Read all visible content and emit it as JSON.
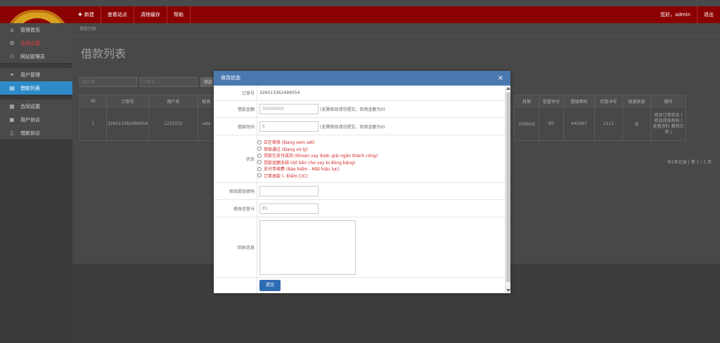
{
  "topbar": {
    "nav": [
      {
        "label": "新建",
        "icon": "plus-icon"
      },
      {
        "label": "查看站点"
      },
      {
        "label": "清除缓存"
      },
      {
        "label": "帮助"
      }
    ],
    "greeting": "您好，admin",
    "logout": "退出"
  },
  "sidebar": {
    "items": [
      {
        "label": "管理首页",
        "icon": "home-icon"
      },
      {
        "label": "系统设置",
        "icon": "gear-icon"
      },
      {
        "label": "网站管理员",
        "icon": "user-icon"
      },
      {
        "label": "用户管理",
        "icon": "users-icon"
      },
      {
        "label": "借款列表",
        "icon": "list-icon"
      },
      {
        "label": "合同设置",
        "icon": "contract-icon"
      },
      {
        "label": "用户协议",
        "icon": "agreement-icon"
      },
      {
        "label": "借款协议",
        "icon": "document-icon"
      }
    ]
  },
  "main": {
    "breadcrumb": "借款列表",
    "title": "借款列表",
    "filters": {
      "username_placeholder": "用户名",
      "order_placeholder": "订单号",
      "filter_button": "筛选"
    },
    "table": {
      "headers_left": [
        "ID",
        "订单号",
        "用户名",
        "姓名"
      ],
      "headers_right": [
        "月供",
        "信誉评分",
        "提现密码",
        "打款卡号",
        "核退状态",
        "操作"
      ],
      "row_left": [
        "1",
        "326013362499054",
        "1233333",
        "ada"
      ],
      "row_right": [
        "70000元",
        "85",
        "445687",
        "1111",
        "无",
        "修改订单状态 | 修改提现密码 | 查看资料 删除订单 |"
      ]
    },
    "pager": "共1条记录 | 第 1 / 1 页"
  },
  "modal": {
    "title": "修改状态",
    "close": "×",
    "order_label": "订单号",
    "order_value": "326013362499054",
    "amount_label": "借款金额",
    "amount_value": "30000000",
    "amount_hint": "(无需修改请勿提交，否则金额为0)",
    "term_label": "借款时间",
    "term_value": "6",
    "term_hint": "(无需修改请勿提交，否则金额为0)",
    "status_label": "状态",
    "status_options": [
      "正在审核 (Đang xem xét)",
      "审核通过 (Đang xử lý)",
      "贷款已支付成功 (Khoản vay được giải ngân thành công)",
      "贷款金额冻结 (Số tiền cho vay bị đóng băng)",
      "支付手续费 (Bảo hiểm - Mất hiệu lực)",
      "订单退款 (- Điểm CIC)"
    ],
    "withdraw_pwd_label": "修改提现密码",
    "withdraw_pwd_value": "",
    "credit_label": "修改信誉分",
    "credit_value": "85",
    "reply_label": "回执信息",
    "reply_value": "",
    "submit": "提交"
  }
}
